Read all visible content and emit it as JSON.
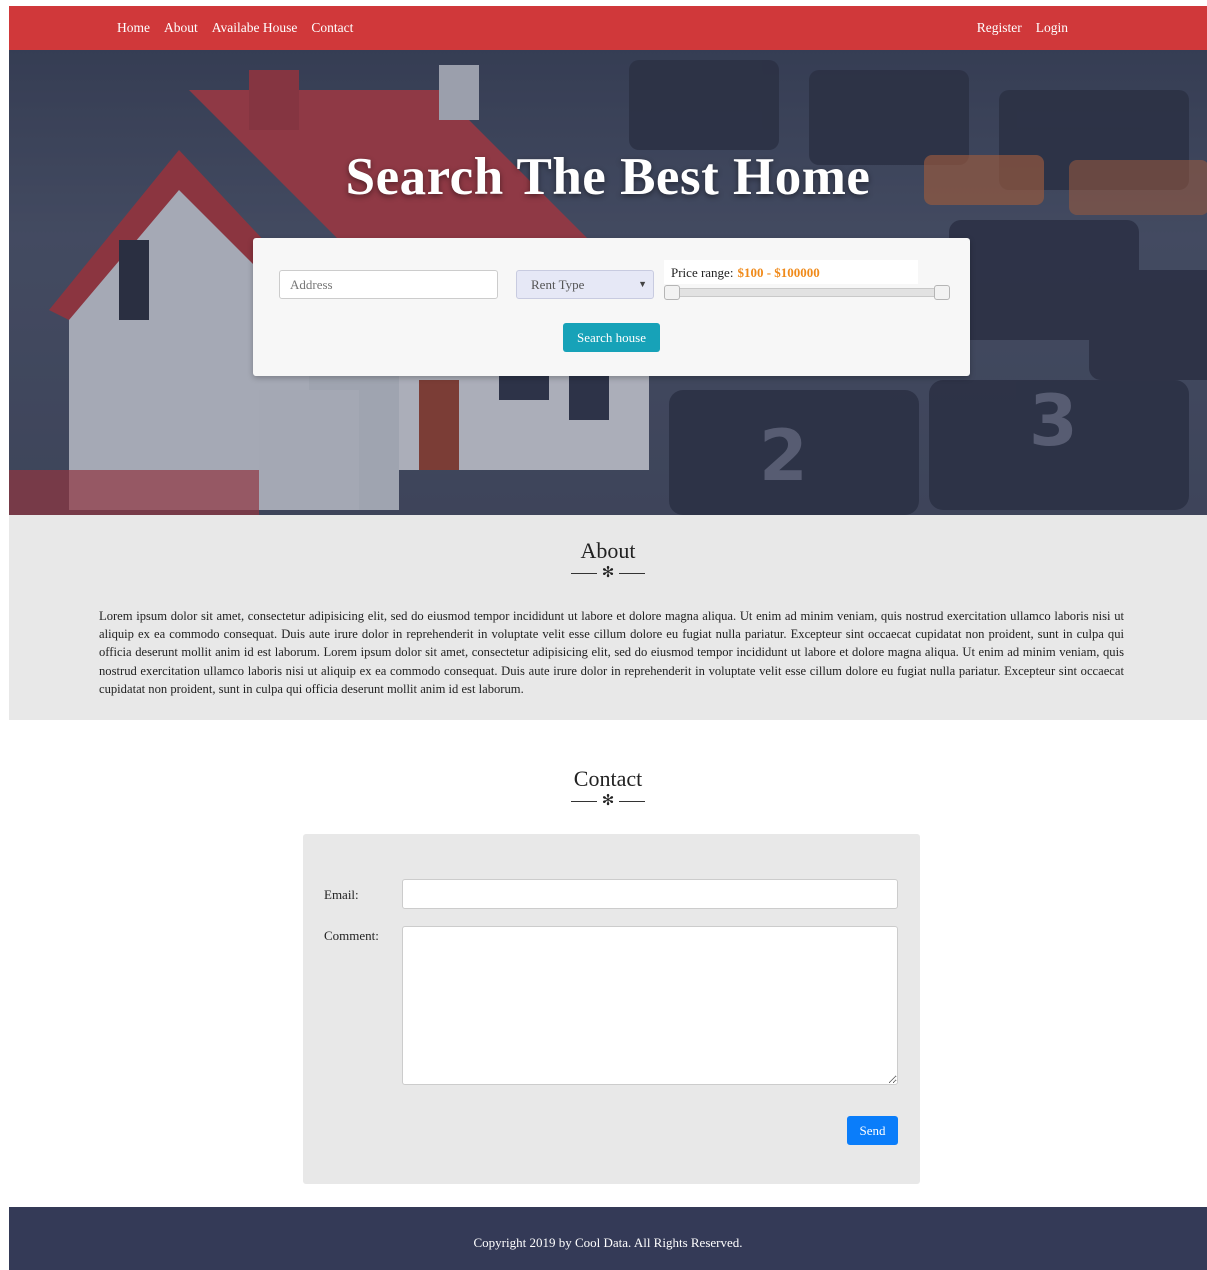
{
  "nav": {
    "links": [
      "Home",
      "About",
      "Availabe House",
      "Contact"
    ],
    "auth": [
      "Register",
      "Login"
    ]
  },
  "hero": {
    "title": "Search The Best Home",
    "address_placeholder": "Address",
    "rent_type_label": "Rent Type",
    "price_range_label": "Price range:",
    "price_range_value": "$100 - $100000",
    "search_button": "Search house"
  },
  "about": {
    "title": "About",
    "divider_symbol": "✻",
    "text": "Lorem ipsum dolor sit amet, consectetur adipisicing elit, sed do eiusmod tempor incididunt ut labore et dolore magna aliqua. Ut enim ad minim veniam, quis nostrud exercitation ullamco laboris nisi ut aliquip ex ea commodo consequat. Duis aute irure dolor in reprehenderit in voluptate velit esse cillum dolore eu fugiat nulla pariatur. Excepteur sint occaecat cupidatat non proident, sunt in culpa qui officia deserunt mollit anim id est laborum. Lorem ipsum dolor sit amet, consectetur adipisicing elit, sed do eiusmod tempor incididunt ut labore et dolore magna aliqua. Ut enim ad minim veniam, quis nostrud exercitation ullamco laboris nisi ut aliquip ex ea commodo consequat. Duis aute irure dolor in reprehenderit in voluptate velit esse cillum dolore eu fugiat nulla pariatur. Excepteur sint occaecat cupidatat non proident, sunt in culpa qui officia deserunt mollit anim id est laborum."
  },
  "contact": {
    "title": "Contact",
    "divider_symbol": "✻",
    "email_label": "Email:",
    "comment_label": "Comment:",
    "send_button": "Send"
  },
  "footer": {
    "text": "Copyright 2019 by Cool Data. All Rights Reserved."
  },
  "colors": {
    "navbar": "#d0383a",
    "search_button": "#17a2b8",
    "send_button": "#0a7dfa",
    "price_accent": "#f08a1a",
    "footer": "#343a57"
  },
  "icons": {
    "rent_type_arrow": "caret-down-icon",
    "section_divider": "asterisk-divider-icon"
  }
}
